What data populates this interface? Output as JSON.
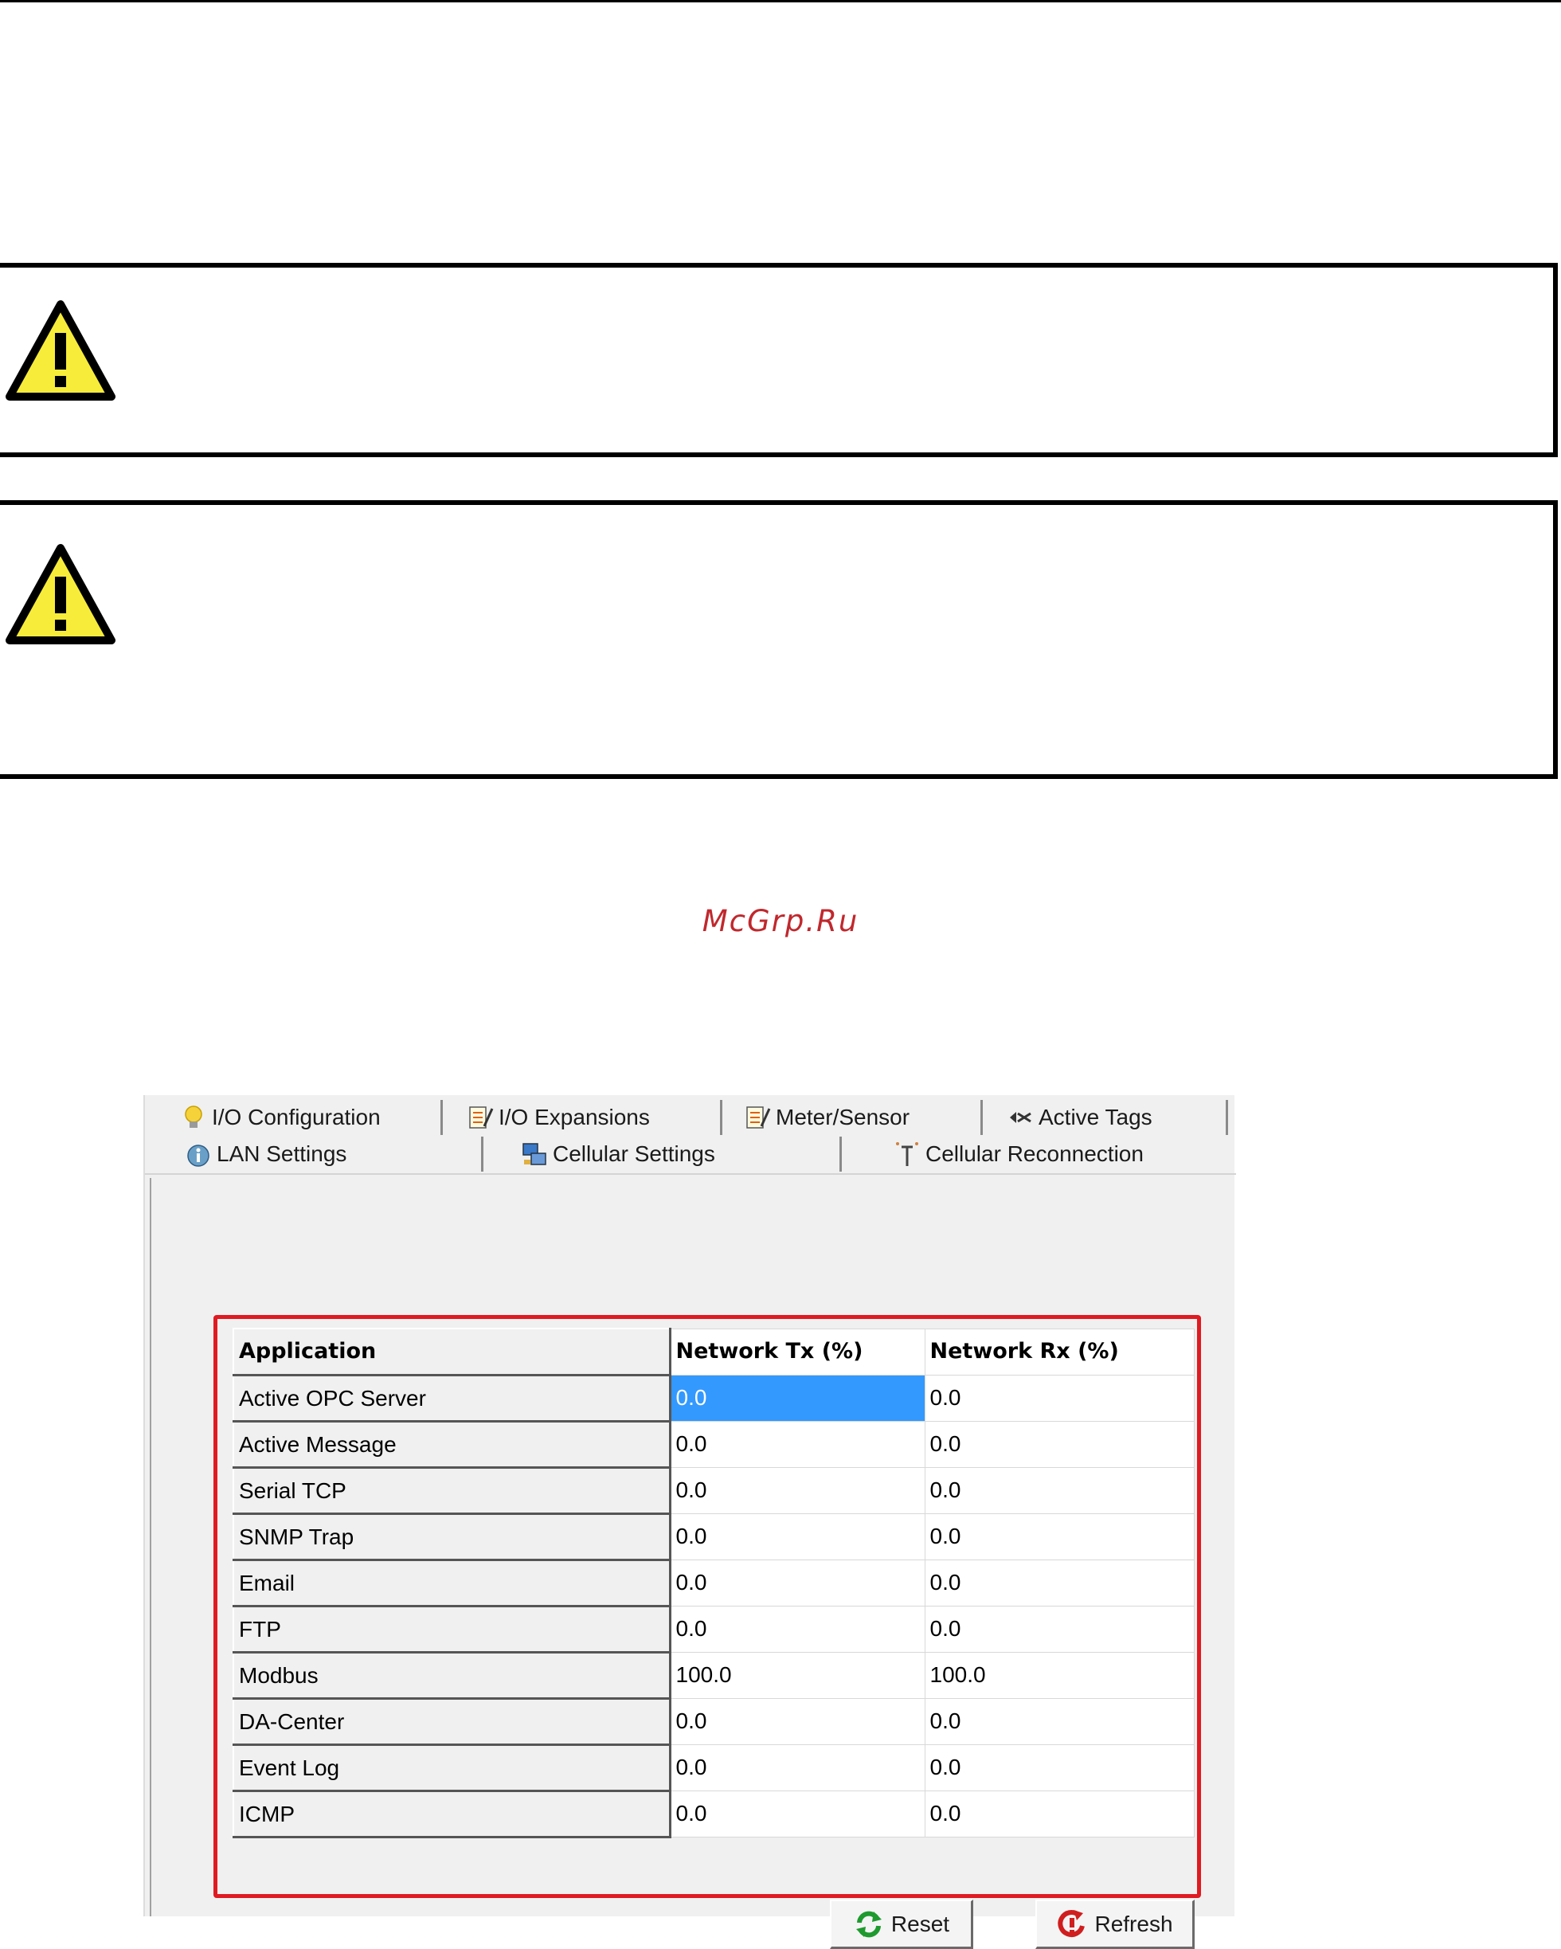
{
  "watermark": "McGrp.Ru",
  "tabs_row1": [
    {
      "label": "I/O Configuration",
      "icon": "lightbulb-icon"
    },
    {
      "label": "I/O Expansions",
      "icon": "notepad-edit-icon"
    },
    {
      "label": "Meter/Sensor",
      "icon": "notepad-edit-icon"
    },
    {
      "label": "Active Tags",
      "icon": "tags-icon"
    }
  ],
  "tabs_row2": [
    {
      "label": "LAN Settings",
      "icon": "info-globe-icon"
    },
    {
      "label": "Cellular Settings",
      "icon": "network-computer-icon"
    },
    {
      "label": "Cellular Reconnection",
      "icon": "antenna-icon"
    }
  ],
  "table": {
    "headers": [
      "Application",
      "Network Tx (%)",
      "Network Rx (%)"
    ],
    "rows": [
      {
        "app": "Active OPC Server",
        "tx": "0.0",
        "rx": "0.0"
      },
      {
        "app": "Active Message",
        "tx": "0.0",
        "rx": "0.0"
      },
      {
        "app": "Serial TCP",
        "tx": "0.0",
        "rx": "0.0"
      },
      {
        "app": "SNMP Trap",
        "tx": "0.0",
        "rx": "0.0"
      },
      {
        "app": "Email",
        "tx": "0.0",
        "rx": "0.0"
      },
      {
        "app": "FTP",
        "tx": "0.0",
        "rx": "0.0"
      },
      {
        "app": "Modbus",
        "tx": "100.0",
        "rx": "100.0"
      },
      {
        "app": "DA-Center",
        "tx": "0.0",
        "rx": "0.0"
      },
      {
        "app": "Event Log",
        "tx": "0.0",
        "rx": "0.0"
      },
      {
        "app": "ICMP",
        "tx": "0.0",
        "rx": "0.0"
      }
    ]
  },
  "buttons": {
    "reset": "Reset",
    "refresh": "Refresh"
  },
  "colors": {
    "highlight": "#e01a22",
    "selection": "#3399ff",
    "warning_yellow": "#f7ec3a"
  }
}
